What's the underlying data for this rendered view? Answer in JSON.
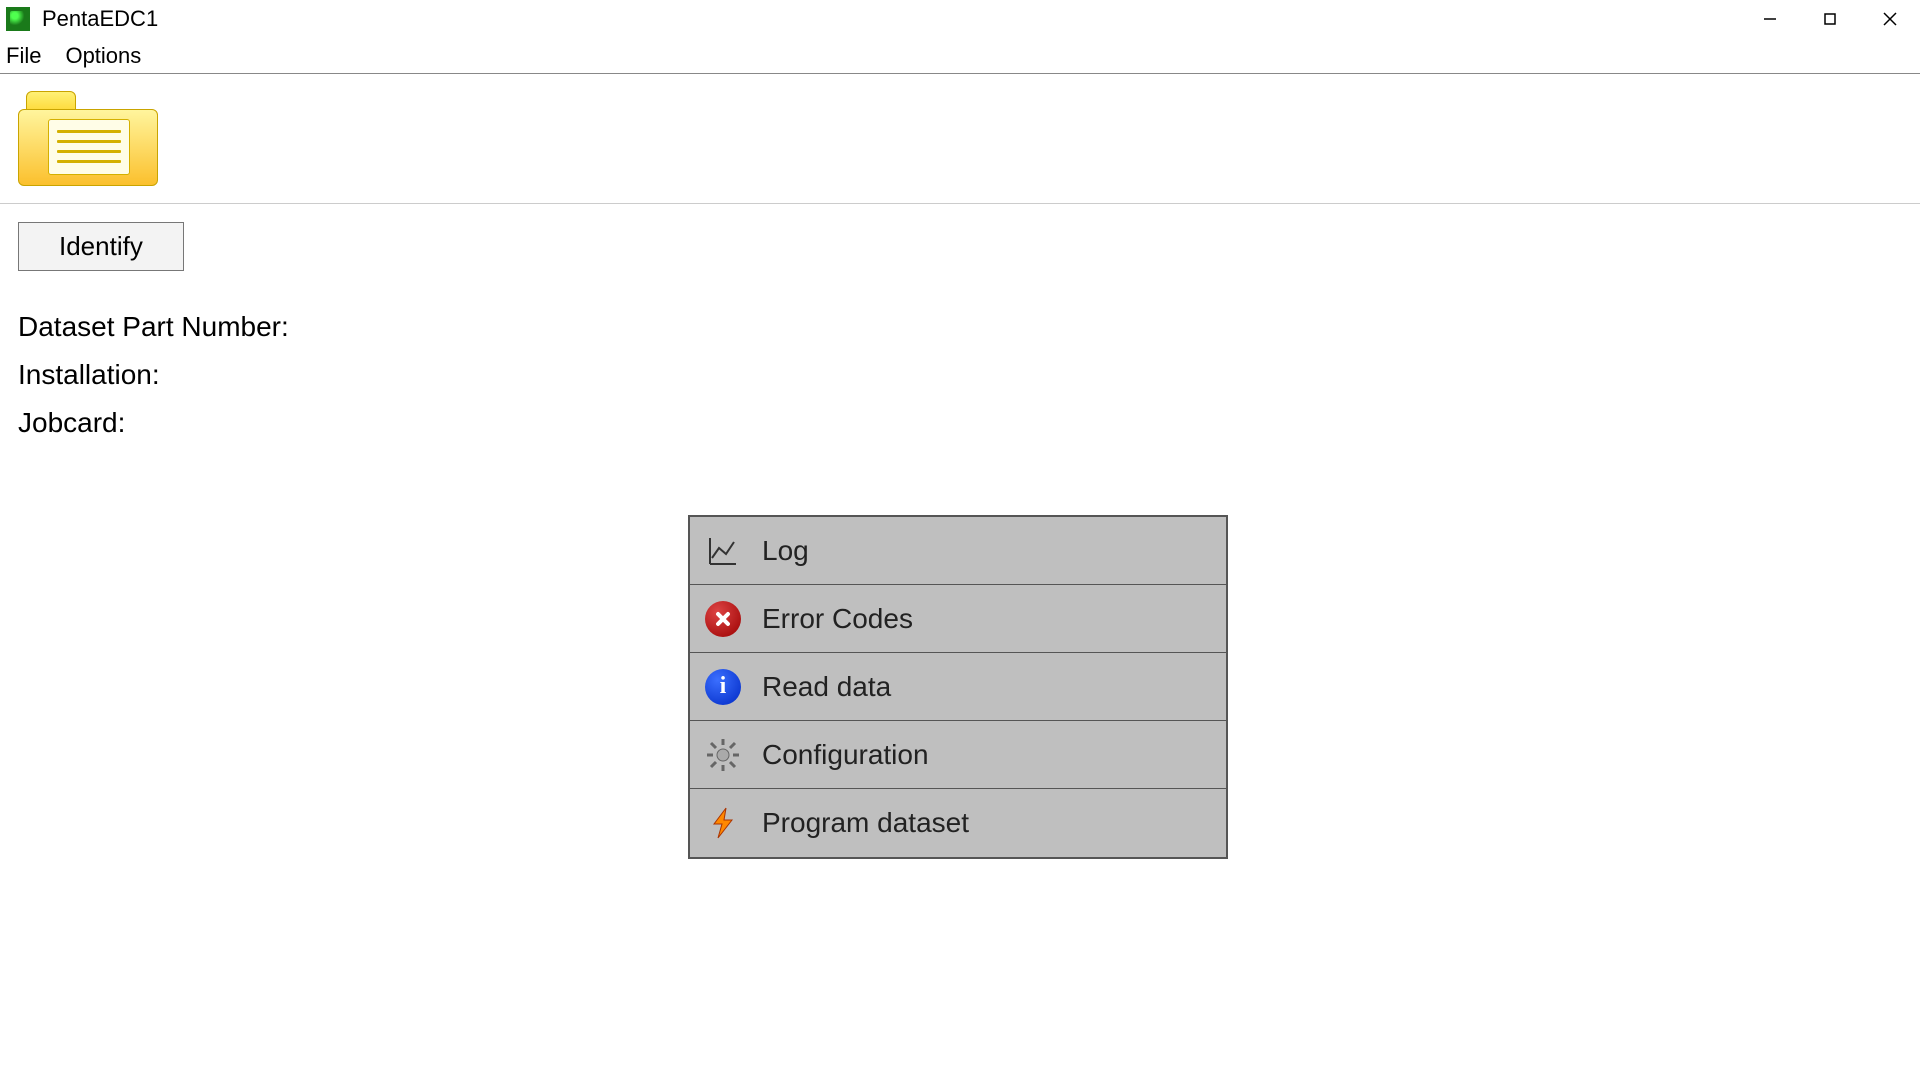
{
  "window": {
    "title": "PentaEDC1"
  },
  "menu": {
    "file": "File",
    "options": "Options"
  },
  "buttons": {
    "identify": "Identify"
  },
  "info": {
    "dataset_part_number_label": "Dataset Part Number:",
    "installation_label": "Installation:",
    "jobcard_label": "Jobcard:"
  },
  "actions": {
    "log": "Log",
    "error_codes": "Error Codes",
    "read_data": "Read data",
    "configuration": "Configuration",
    "program_dataset": "Program dataset"
  }
}
